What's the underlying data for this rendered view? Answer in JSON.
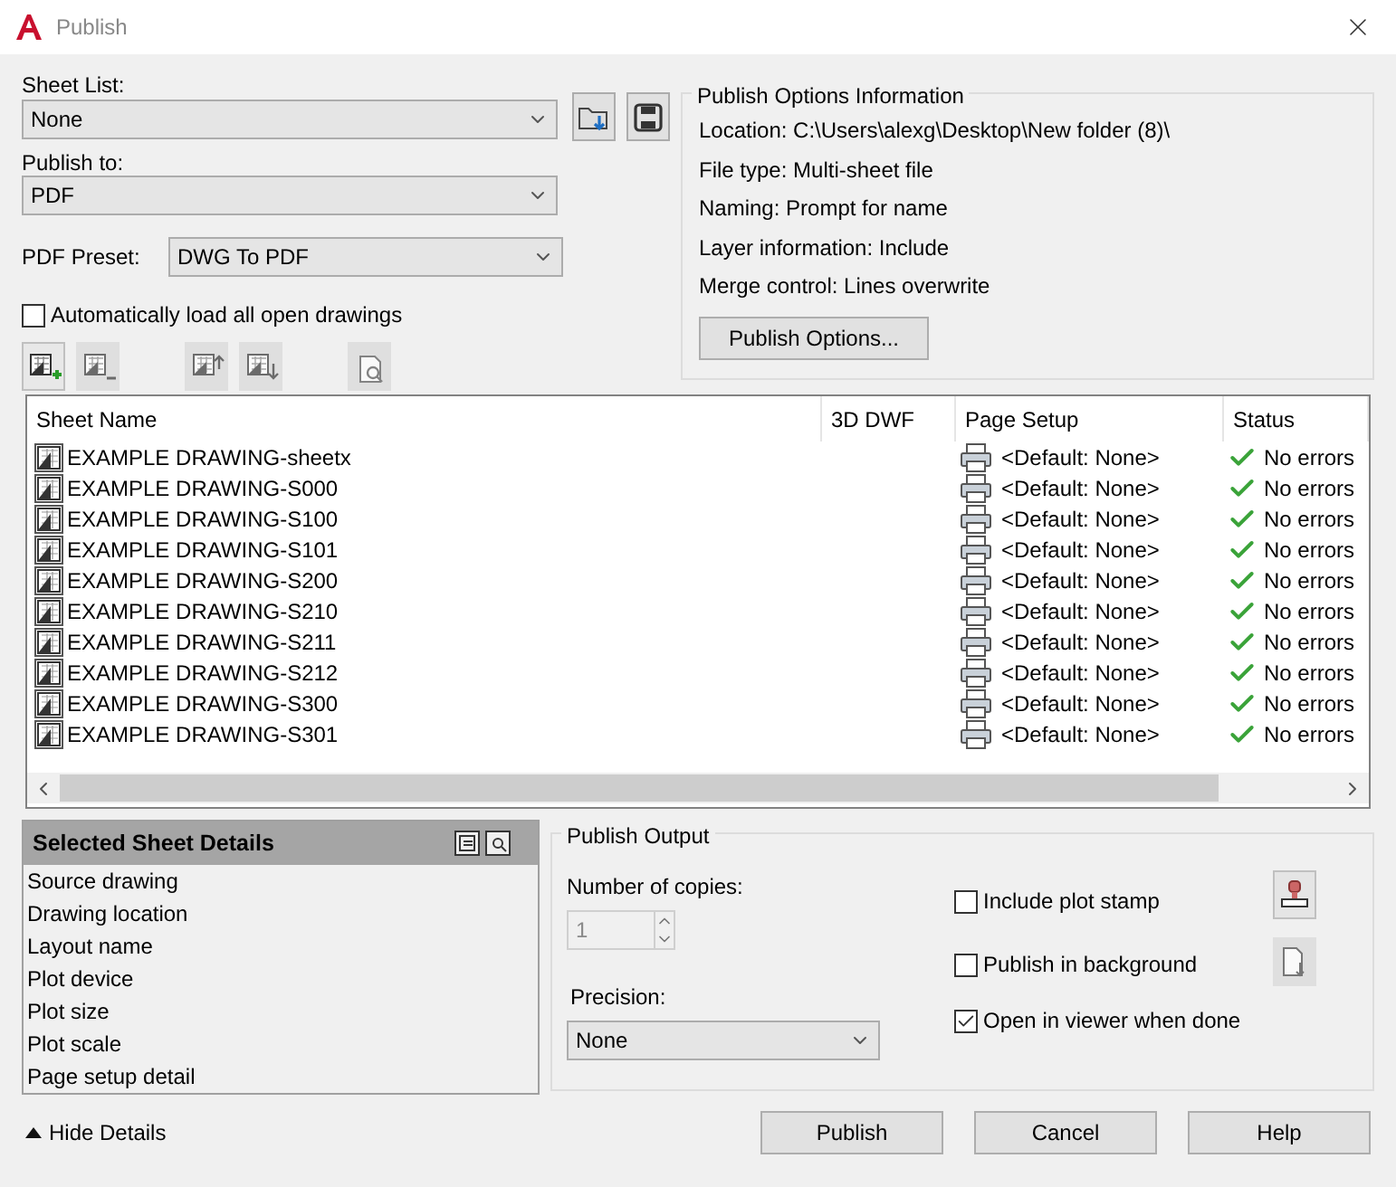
{
  "window": {
    "title": "Publish"
  },
  "sheet_list": {
    "label": "Sheet List:",
    "value": "None"
  },
  "publish_to": {
    "label": "Publish to:",
    "value": "PDF"
  },
  "pdf_preset": {
    "label": "PDF Preset:",
    "value": "DWG To PDF"
  },
  "auto_load": {
    "label": "Automatically load all open drawings",
    "checked": false
  },
  "toolbar": [
    {
      "kind": "add",
      "disabled": false
    },
    {
      "kind": "remove",
      "disabled": true
    },
    {
      "kind": "move_up",
      "disabled": true
    },
    {
      "kind": "move_down",
      "disabled": true
    },
    {
      "kind": "preview",
      "disabled": true
    }
  ],
  "options_info": {
    "title": "Publish Options Information",
    "lines": [
      "Location: C:\\Users\\alexg\\Desktop\\New folder (8)\\",
      "File type: Multi-sheet file",
      "Naming: Prompt for name",
      "Layer information: Include",
      "Merge control: Lines overwrite"
    ],
    "button": "Publish Options..."
  },
  "table": {
    "columns": [
      "Sheet Name",
      "3D DWF",
      "Page Setup",
      "Status"
    ],
    "rows": [
      {
        "sheet_name": "EXAMPLE DRAWING-sheetx",
        "page_setup": "<Default: None>",
        "status": "No errors"
      },
      {
        "sheet_name": "EXAMPLE DRAWING-S000",
        "page_setup": "<Default: None>",
        "status": "No errors"
      },
      {
        "sheet_name": "EXAMPLE DRAWING-S100",
        "page_setup": "<Default: None>",
        "status": "No errors"
      },
      {
        "sheet_name": "EXAMPLE DRAWING-S101",
        "page_setup": "<Default: None>",
        "status": "No errors"
      },
      {
        "sheet_name": "EXAMPLE DRAWING-S200",
        "page_setup": "<Default: None>",
        "status": "No errors"
      },
      {
        "sheet_name": "EXAMPLE DRAWING-S210",
        "page_setup": "<Default: None>",
        "status": "No errors"
      },
      {
        "sheet_name": "EXAMPLE DRAWING-S211",
        "page_setup": "<Default: None>",
        "status": "No errors"
      },
      {
        "sheet_name": "EXAMPLE DRAWING-S212",
        "page_setup": "<Default: None>",
        "status": "No errors"
      },
      {
        "sheet_name": "EXAMPLE DRAWING-S300",
        "page_setup": "<Default: None>",
        "status": "No errors"
      },
      {
        "sheet_name": "EXAMPLE DRAWING-S301",
        "page_setup": "<Default: None>",
        "status": "No errors"
      }
    ]
  },
  "details": {
    "title": "Selected Sheet Details",
    "items": [
      "Source drawing",
      "Drawing location",
      "Layout name",
      "Plot device",
      "Plot size",
      "Plot scale",
      "Page setup detail"
    ]
  },
  "publish_output": {
    "title": "Publish Output",
    "copies": {
      "label": "Number of copies:",
      "value": "1",
      "disabled": true
    },
    "precision": {
      "label": "Precision:",
      "value": "None"
    },
    "checkboxes": [
      {
        "label": "Include plot stamp",
        "checked": false
      },
      {
        "label": "Publish in background",
        "checked": false
      },
      {
        "label": "Open in viewer when done",
        "checked": true
      }
    ],
    "side_buttons": [
      {
        "kind": "stamp",
        "disabled": false
      },
      {
        "kind": "copy",
        "disabled": true
      }
    ]
  },
  "hide_details": "Hide Details",
  "buttons": [
    "Publish",
    "Cancel",
    "Help"
  ]
}
